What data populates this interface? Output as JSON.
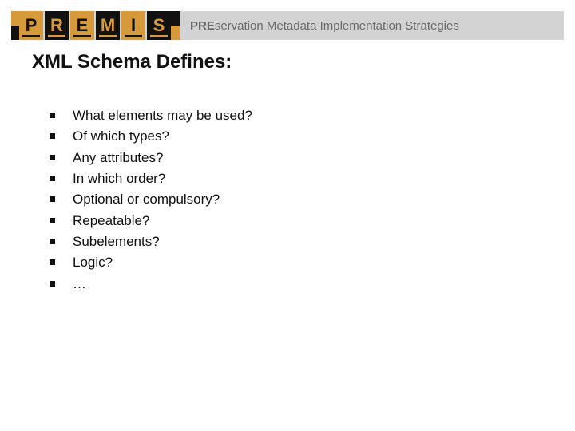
{
  "header": {
    "logo_letters": [
      "P",
      "R",
      "E",
      "M",
      "I",
      "S"
    ],
    "tagline_bold": "PRE",
    "tagline_rest": "servation Metadata Implementation Strategies"
  },
  "title": "XML Schema Defines:",
  "bullets": [
    "What elements may be used?",
    "Of which types?",
    "Any attributes?",
    "In which order?",
    "Optional or compulsory?",
    "Repeatable?",
    "Subelements?",
    "Logic?",
    "…"
  ]
}
